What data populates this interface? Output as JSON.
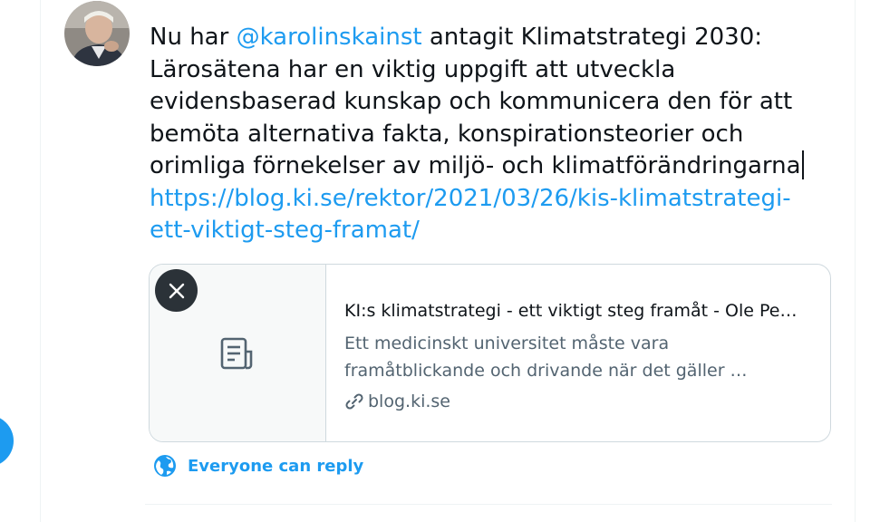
{
  "composer": {
    "text_prefix": "Nu har ",
    "mention": "@karolinskainst",
    "text_main": " antagit Klimatstrategi 2030: Lärosätena har en viktig uppgift att utveckla evidensbaserad kunskap och kommunicera den för att bemöta alternativa fakta, konspirationsteorier och orimliga förnekelser av miljö- och klimatförändringarna",
    "link": "https://blog.ki.se/rektor/2021/03/26/kis-klimatstrategi-ett-viktigt-steg-framat/",
    "link_line1": "https://blog.ki.se/rektor/2021/03/26/kis-klimatstrategi-",
    "link_line2": "ett-viktigt-steg-framat/"
  },
  "link_card": {
    "title": "KI:s klimatstrategi - ett viktigt steg framåt - Ole Pe…",
    "description_line1": "Ett medicinskt universitet måste vara",
    "description_line2": "framåtblickande och drivande när det gäller …",
    "domain": "blog.ki.se",
    "thumbnail_icon": "document-icon",
    "close_icon": "close-icon",
    "link_icon": "link-icon"
  },
  "reply_setting": {
    "label": "Everyone can reply",
    "icon": "globe-icon"
  },
  "colors": {
    "accent": "#1d9bf0",
    "text": "#0f1419",
    "secondary_text": "#536471",
    "border": "#cfd9de"
  }
}
